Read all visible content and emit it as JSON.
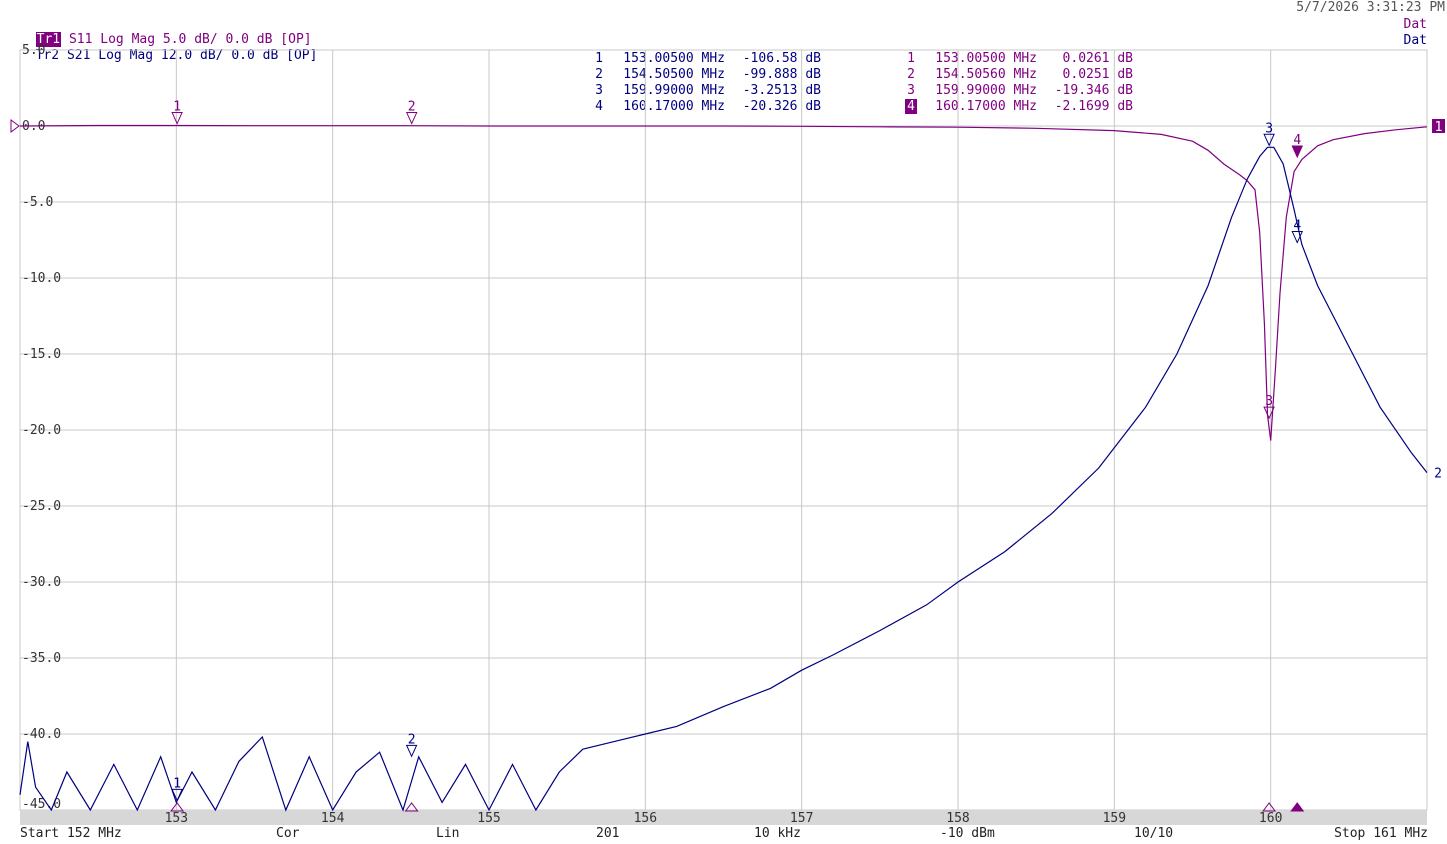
{
  "header": {
    "datetime": "5/7/2026 3:31:23 PM",
    "traces": [
      {
        "tag": "Tr1",
        "text": " S11 Log Mag 5.0 dB/ 0.0 dB [OP]",
        "status": "Dat"
      },
      {
        "tag": "Tr2",
        "text": " S21 Log Mag 12.0 dB/ 0.0 dB [OP]",
        "status": "Dat"
      }
    ]
  },
  "marker_tables": {
    "tr2": [
      {
        "num": "1",
        "freq": "153.00500 MHz",
        "val": "-106.58 dB"
      },
      {
        "num": "2",
        "freq": "154.50500 MHz",
        "val": "-99.888 dB"
      },
      {
        "num": "3",
        "freq": "159.99000 MHz",
        "val": "-3.2513 dB"
      },
      {
        "num": "4",
        "freq": "160.17000 MHz",
        "val": "-20.326 dB"
      }
    ],
    "tr1": [
      {
        "num": "1",
        "freq": "153.00500 MHz",
        "val": "0.0261 dB"
      },
      {
        "num": "2",
        "freq": "154.50560 MHz",
        "val": "0.0251 dB"
      },
      {
        "num": "3",
        "freq": "159.99000 MHz",
        "val": "-19.346 dB"
      },
      {
        "num": "4",
        "freq": "160.17000 MHz",
        "val": "-2.1699 dB"
      }
    ]
  },
  "footer": {
    "start": "Start 152 MHz",
    "mode": "Cor",
    "sweep": "Lin",
    "points": "201",
    "ifbw": "10 kHz",
    "power": "-10 dBm",
    "avg": "10/10",
    "stop": "Stop 161 MHz"
  },
  "colors": {
    "s11": "#800080",
    "s21": "#000080",
    "grid": "#c8c8c8"
  },
  "chart_data": {
    "type": "line",
    "xlim": [
      152,
      161
    ],
    "ylim": [
      -45,
      5
    ],
    "x_ticks": [
      153,
      154,
      155,
      156,
      157,
      158,
      159,
      160
    ],
    "x_tick_labels": [
      "153",
      "154",
      "155",
      "156",
      "157",
      "158",
      "159",
      "160"
    ],
    "y_ticks": [
      5,
      0,
      -5,
      -10,
      -15,
      -20,
      -25,
      -30,
      -35,
      -40,
      -45
    ],
    "y_tick_labels": [
      "5.0",
      "0.0",
      "-5.0",
      "-10.0",
      "-15.0",
      "-20.0",
      "-25.0",
      "-30.0",
      "-35.0",
      "-40.0",
      "-45.0"
    ],
    "grid": true,
    "series": [
      {
        "name": "S11",
        "color": "#800080",
        "x": [
          152.0,
          152.5,
          153.0,
          153.5,
          154.0,
          154.5,
          155.0,
          155.5,
          156.0,
          156.5,
          157.0,
          157.5,
          158.0,
          158.5,
          159.0,
          159.3,
          159.5,
          159.6,
          159.7,
          159.8,
          159.85,
          159.9,
          159.93,
          159.96,
          159.98,
          160.0,
          160.03,
          160.06,
          160.1,
          160.15,
          160.2,
          160.3,
          160.4,
          160.6,
          160.8,
          161.0
        ],
        "y": [
          0.0,
          0.03,
          0.03,
          0.02,
          0.02,
          0.02,
          0.0,
          0.0,
          0.0,
          0.0,
          -0.02,
          -0.05,
          -0.08,
          -0.15,
          -0.3,
          -0.55,
          -1.0,
          -1.6,
          -2.5,
          -3.2,
          -3.6,
          -4.2,
          -7.0,
          -13.0,
          -19.0,
          -20.7,
          -16.0,
          -11.0,
          -6.0,
          -3.0,
          -2.2,
          -1.3,
          -0.9,
          -0.5,
          -0.25,
          -0.05
        ],
        "markers": [
          {
            "id": "1",
            "x": 153.005,
            "y": 0.03
          },
          {
            "id": "2",
            "x": 154.5056,
            "y": 0.03
          },
          {
            "id": "3",
            "x": 159.99,
            "y": -19.35
          },
          {
            "id": "4",
            "x": 160.17,
            "y": -2.17
          }
        ]
      },
      {
        "name": "S21",
        "color": "#000080",
        "x": [
          152.0,
          152.05,
          152.1,
          152.2,
          152.3,
          152.45,
          152.6,
          152.75,
          152.9,
          153.0,
          153.1,
          153.25,
          153.4,
          153.55,
          153.7,
          153.85,
          154.0,
          154.15,
          154.3,
          154.45,
          154.55,
          154.7,
          154.85,
          155.0,
          155.15,
          155.3,
          155.45,
          155.6,
          155.8,
          156.0,
          156.2,
          156.5,
          156.8,
          157.0,
          157.2,
          157.5,
          157.8,
          158.0,
          158.3,
          158.6,
          158.9,
          159.2,
          159.4,
          159.6,
          159.75,
          159.85,
          159.93,
          159.98,
          160.02,
          160.08,
          160.15,
          160.2,
          160.3,
          160.5,
          160.7,
          160.9,
          161.0
        ],
        "y": [
          -44.0,
          -40.5,
          -43.5,
          -45.0,
          -42.5,
          -45.5,
          -42.0,
          -45.0,
          -41.5,
          -44.5,
          -42.5,
          -45.5,
          -41.8,
          -40.2,
          -45.0,
          -41.5,
          -45.0,
          -42.5,
          -41.2,
          -45.0,
          -41.5,
          -44.5,
          -42.0,
          -45.5,
          -42.0,
          -45.0,
          -42.5,
          -41.0,
          -40.5,
          -40.0,
          -39.5,
          -38.2,
          -37.0,
          -35.8,
          -34.8,
          -33.2,
          -31.5,
          -30.0,
          -28.0,
          -25.5,
          -22.5,
          -18.5,
          -15.0,
          -10.5,
          -6.0,
          -3.5,
          -2.0,
          -1.4,
          -1.4,
          -2.5,
          -5.5,
          -7.8,
          -10.5,
          -14.5,
          -18.5,
          -21.5,
          -22.8
        ],
        "markers": [
          {
            "id": "1",
            "x": 153.005,
            "y": -44.5
          },
          {
            "id": "2",
            "x": 154.505,
            "y": -41.6
          },
          {
            "id": "3",
            "x": 159.99,
            "y": -1.4
          },
          {
            "id": "4",
            "x": 160.17,
            "y": -7.8
          }
        ]
      }
    ]
  }
}
